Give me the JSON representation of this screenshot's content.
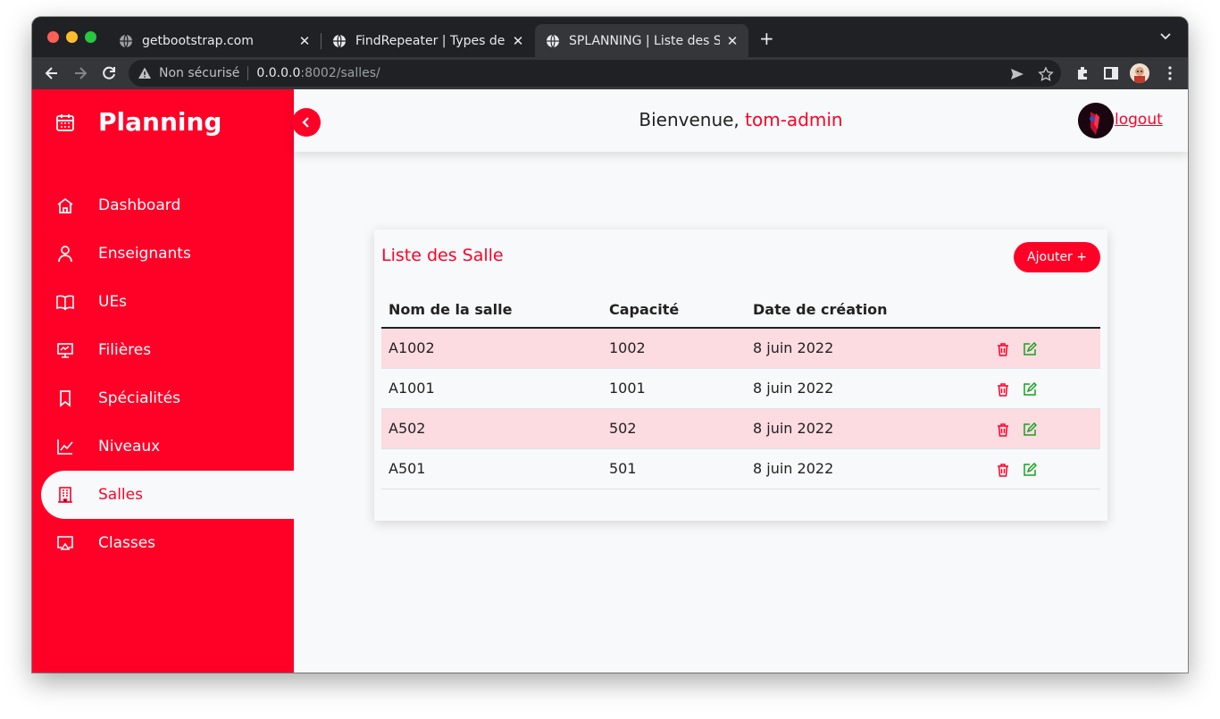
{
  "browser": {
    "tabs": [
      {
        "title": "getbootstrap.com",
        "active": false
      },
      {
        "title": "FindRepeater | Types de co",
        "active": false
      },
      {
        "title": "SPLANNING | Liste des Sal",
        "active": true
      }
    ],
    "security_label": "Non sécurisé",
    "url_host": "0.0.0.0",
    "url_rest": ":8002/salles/"
  },
  "sidebar": {
    "brand": "Planning",
    "items": [
      {
        "label": "Dashboard",
        "icon": "home-icon",
        "active": false
      },
      {
        "label": "Enseignants",
        "icon": "user-icon",
        "active": false
      },
      {
        "label": "UEs",
        "icon": "book-icon",
        "active": false
      },
      {
        "label": "Filières",
        "icon": "presentation-icon",
        "active": false
      },
      {
        "label": "Spécialités",
        "icon": "bookmark-icon",
        "active": false
      },
      {
        "label": "Niveaux",
        "icon": "chart-line-icon",
        "active": false
      },
      {
        "label": "Salles",
        "icon": "building-icon",
        "active": true
      },
      {
        "label": "Classes",
        "icon": "screen-icon",
        "active": false
      }
    ]
  },
  "header": {
    "welcome": "Bienvenue, ",
    "username": "tom-admin",
    "logout": "logout"
  },
  "card": {
    "title": "Liste des Salle",
    "add_button": "Ajouter +",
    "columns": [
      "Nom de la salle",
      "Capacité",
      "Date de création",
      ""
    ],
    "rows": [
      [
        "A1002",
        "1002",
        "8 juin 2022"
      ],
      [
        "A1001",
        "1001",
        "8 juin 2022"
      ],
      [
        "A502",
        "502",
        "8 juin 2022"
      ],
      [
        "A501",
        "501",
        "8 juin 2022"
      ]
    ]
  },
  "colors": {
    "brand": "#ff0027",
    "stripe": "#fcdbe1",
    "edit": "#17a11f"
  }
}
